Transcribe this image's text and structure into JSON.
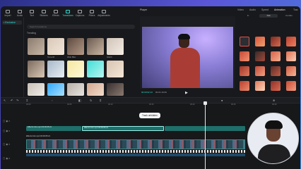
{
  "toolbar_tabs": [
    {
      "label": "Import",
      "active": false
    },
    {
      "label": "Audio",
      "active": false
    },
    {
      "label": "Text",
      "active": false
    },
    {
      "label": "Stickers",
      "active": false
    },
    {
      "label": "Effects",
      "active": false
    },
    {
      "label": "Transitions",
      "active": true
    },
    {
      "label": "Captions",
      "active": false
    },
    {
      "label": "Filters",
      "active": false
    },
    {
      "label": "Adjustments",
      "active": false
    }
  ],
  "left_panel": {
    "active_item": "• Exclusive"
  },
  "media": {
    "search_placeholder": "Search transitions",
    "section_label": "Trending"
  },
  "thumb_labels": [
    "",
    "",
    "",
    "",
    "",
    "Tone Ri",
    "Wob Blur",
    "Glitch",
    "",
    "",
    "",
    "",
    "",
    "",
    "",
    ""
  ],
  "player": {
    "title": "Player",
    "timecode": "00:00:02:13",
    "duration": "00:21:19:29",
    "play_icon": "▶"
  },
  "right_panel": {
    "tabs": [
      "Video",
      "Audio",
      "Speed",
      "Animation",
      "Trac"
    ],
    "active_tab": "Animation",
    "subtabs": [
      "In",
      "Out",
      "Combo"
    ],
    "active_subtab": "Out"
  },
  "timeline": {
    "ruler": [
      "00:00",
      "00:05",
      "00:10",
      "00:15",
      "00:20",
      "00:25",
      "00:30"
    ],
    "video_clip_name": "Effects Intro.mp4   00:00:05:21",
    "tooltip": "Track unhidden"
  },
  "colors": {
    "accent": "#2ee0d6",
    "panel": "#18191c"
  }
}
